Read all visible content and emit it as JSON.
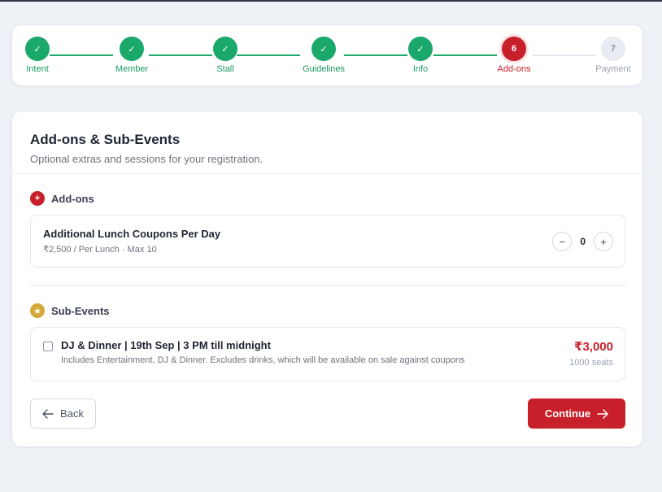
{
  "stepper": {
    "steps": [
      {
        "label": "Intent",
        "marker": "✓",
        "state": "done"
      },
      {
        "label": "Member",
        "marker": "✓",
        "state": "done"
      },
      {
        "label": "Stall",
        "marker": "✓",
        "state": "done"
      },
      {
        "label": "Guidelines",
        "marker": "✓",
        "state": "done"
      },
      {
        "label": "Info",
        "marker": "✓",
        "state": "done"
      },
      {
        "label": "Add-ons",
        "marker": "6",
        "state": "active"
      },
      {
        "label": "Payment",
        "marker": "7",
        "state": "pending"
      }
    ]
  },
  "page": {
    "title": "Add-ons & Sub-Events",
    "subtitle": "Optional extras and sessions for your registration."
  },
  "addons": {
    "heading": "Add-ons",
    "badge_icon": "plus-icon",
    "items": [
      {
        "name": "Additional Lunch Coupons Per Day",
        "meta": "₹2,500 / Per Lunch · Max 10",
        "quantity": "0",
        "minus_label": "−",
        "plus_label": "+"
      }
    ]
  },
  "sub_events": {
    "heading": "Sub-Events",
    "badge_icon": "star-icon",
    "items": [
      {
        "name": "DJ & Dinner | 19th Sep | 3 PM till midnight",
        "description": "Includes Entertainment, DJ & Dinner. Excludes drinks, which will be available on sale against coupons",
        "price": "₹3,000",
        "seats": "1000 seats",
        "checked": false
      }
    ]
  },
  "actions": {
    "back_label": "Back",
    "back_icon": "arrow-left-icon",
    "continue_label": "Continue",
    "continue_icon": "arrow-right-icon"
  },
  "colors": {
    "done": "#1aa86b",
    "active": "#c8202a",
    "pending": "#e7ebf2",
    "accent": "#c8202a",
    "star": "#d4a93a"
  }
}
